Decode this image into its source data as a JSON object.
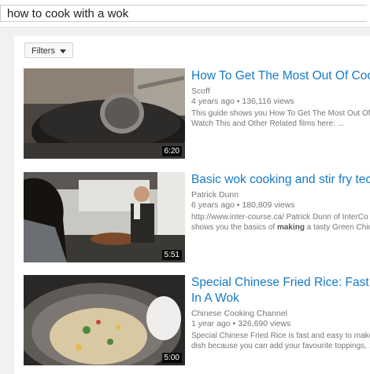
{
  "search": {
    "query": "how to cook with a wok"
  },
  "filters": {
    "label": "Filters"
  },
  "results": [
    {
      "title": "How To Get The Most Out Of Cook",
      "channel": "Scoff",
      "age": "4 years ago",
      "views": "136,116 views",
      "desc1": "This guide shows you How To Get The Most Out Of",
      "desc2": "Watch This and Other Related films here: ...",
      "duration": "6:20"
    },
    {
      "title": "Basic wok cooking and stir fry tech",
      "channel": "Patrick Dunn",
      "age": "6 years ago",
      "views": "180,809 views",
      "desc1": "http://www.inter-course.ca/ Patrick Dunn of InterCo",
      "desc2_pre": "shows you the basics of ",
      "desc2_bold": "making",
      "desc2_post": " a tasty Green Chick",
      "duration": "5:51"
    },
    {
      "title_line1": "Special Chinese Fried Rice: Fast Cl",
      "title_line2": "In A Wok",
      "channel": "Chinese Cooking Channel",
      "age": "1 year ago",
      "views": "326,690 views",
      "desc1": "Special Chinese Fried Rice is fast and easy to make",
      "desc2": "dish because you can add your favourite toppings, .",
      "duration": "5:00"
    }
  ],
  "separator": "•"
}
